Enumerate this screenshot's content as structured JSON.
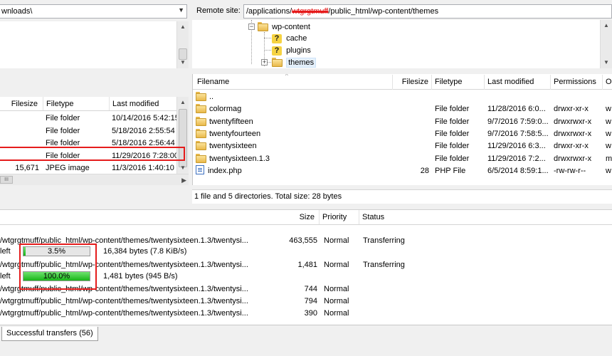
{
  "local": {
    "path": "wnloads\\",
    "columns": {
      "filesize": "Filesize",
      "filetype": "Filetype",
      "modified": "Last modified"
    },
    "rows": [
      {
        "size": "",
        "type": "File folder",
        "modified": "10/14/2016 5:42:15..."
      },
      {
        "size": "",
        "type": "File folder",
        "modified": "5/18/2016 2:55:54 ..."
      },
      {
        "size": "",
        "type": "File folder",
        "modified": "5/18/2016 2:56:44 ..."
      },
      {
        "size": "",
        "type": "File folder",
        "modified": "11/29/2016 7:28:00..."
      },
      {
        "size": "15,671",
        "type": "JPEG image",
        "modified": "11/3/2016 1:40:10 ..."
      }
    ]
  },
  "remote": {
    "site_label": "Remote site:",
    "path_prefix": "/applications/",
    "path_redacted": "wtgrgtmuff",
    "path_suffix": "/public_html/wp-content/themes",
    "tree": [
      {
        "label": "wp-content",
        "icon": "folder-icon"
      },
      {
        "label": "cache",
        "icon": "unknown-folder-icon"
      },
      {
        "label": "plugins",
        "icon": "unknown-folder-icon"
      },
      {
        "label": "themes",
        "icon": "folder-icon"
      }
    ],
    "columns": {
      "filename": "Filename",
      "filesize": "Filesize",
      "filetype": "Filetype",
      "modified": "Last modified",
      "permissions": "Permissions",
      "owner": "O"
    },
    "rows": [
      {
        "name": "..",
        "size": "",
        "type": "",
        "modified": "",
        "perm": "",
        "owner": "",
        "icon": "folder-icon"
      },
      {
        "name": "colormag",
        "size": "",
        "type": "File folder",
        "modified": "11/28/2016 6:0...",
        "perm": "drwxr-xr-x",
        "owner": "w",
        "icon": "folder-icon"
      },
      {
        "name": "twentyfifteen",
        "size": "",
        "type": "File folder",
        "modified": "9/7/2016 7:59:0...",
        "perm": "drwxrwxr-x",
        "owner": "w",
        "icon": "folder-icon"
      },
      {
        "name": "twentyfourteen",
        "size": "",
        "type": "File folder",
        "modified": "9/7/2016 7:58:5...",
        "perm": "drwxrwxr-x",
        "owner": "w",
        "icon": "folder-icon"
      },
      {
        "name": "twentysixteen",
        "size": "",
        "type": "File folder",
        "modified": "11/29/2016 6:3...",
        "perm": "drwxr-xr-x",
        "owner": "w",
        "icon": "folder-icon"
      },
      {
        "name": "twentysixteen.1.3",
        "size": "",
        "type": "File folder",
        "modified": "11/29/2016 7:2...",
        "perm": "drwxrwxr-x",
        "owner": "m",
        "icon": "folder-icon"
      },
      {
        "name": "index.php",
        "size": "28",
        "type": "PHP File",
        "modified": "6/5/2014 8:59:1...",
        "perm": "-rw-rw-r--",
        "owner": "w",
        "icon": "php-file-icon"
      }
    ],
    "status": "1 file and 5 directories. Total size: 28 bytes"
  },
  "queue": {
    "columns": {
      "size": "Size",
      "priority": "Priority",
      "status": "Status"
    },
    "items": [
      {
        "type": "file",
        "path": "/wtgrgtmuff/public_html/wp-content/themes/twentysixteen.1.3/twentysi...",
        "size": "463,555",
        "priority": "Normal",
        "status": "Transferring"
      },
      {
        "type": "progress",
        "label": "left",
        "percent_text": "3.5%",
        "percent": 3.5,
        "detail": "16,384 bytes (7.8 KiB/s)"
      },
      {
        "type": "file",
        "path": "/wtgrgtmuff/public_html/wp-content/themes/twentysixteen.1.3/twentysi...",
        "size": "1,481",
        "priority": "Normal",
        "status": "Transferring"
      },
      {
        "type": "progress",
        "label": "left",
        "percent_text": "100.0%",
        "percent": 100,
        "detail": "1,481 bytes (945 B/s)"
      },
      {
        "type": "file",
        "path": "/wtgrgtmuff/public_html/wp-content/themes/twentysixteen.1.3/twentysi...",
        "size": "744",
        "priority": "Normal",
        "status": ""
      },
      {
        "type": "file",
        "path": "/wtgrgtmuff/public_html/wp-content/themes/twentysixteen.1.3/twentysi...",
        "size": "794",
        "priority": "Normal",
        "status": ""
      },
      {
        "type": "file",
        "path": "/wtgrgtmuff/public_html/wp-content/themes/twentysixteen.1.3/twentysi...",
        "size": "390",
        "priority": "Normal",
        "status": ""
      }
    ],
    "tab_label": "Successful transfers (56)"
  },
  "colors": {
    "highlight": "#e51c1c",
    "progress_green": "#18b418"
  }
}
